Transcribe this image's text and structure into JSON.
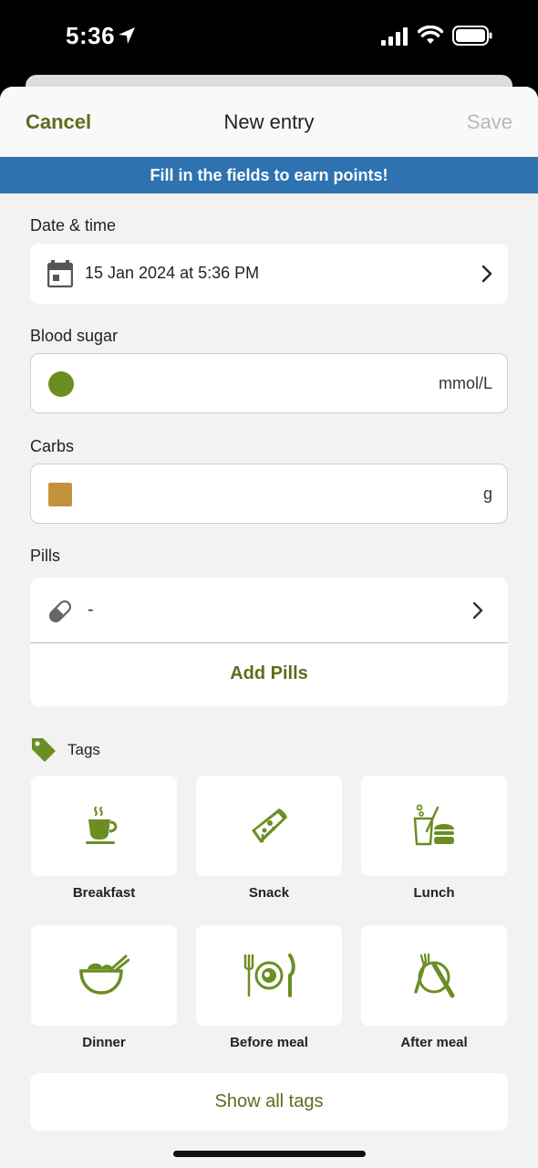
{
  "status_bar": {
    "time": "5:36"
  },
  "nav": {
    "cancel": "Cancel",
    "title": "New entry",
    "save": "Save"
  },
  "banner": {
    "text": "Fill in the fields to earn points!"
  },
  "date_time": {
    "label": "Date & time",
    "value": "15 Jan 2024 at 5:36 PM"
  },
  "blood_sugar": {
    "label": "Blood sugar",
    "unit": "mmol/L",
    "value": ""
  },
  "carbs": {
    "label": "Carbs",
    "unit": "g",
    "value": ""
  },
  "pills": {
    "label": "Pills",
    "value": "-",
    "add_label": "Add Pills"
  },
  "tags": {
    "label": "Tags",
    "items": [
      {
        "label": "Breakfast",
        "icon": "coffee-cup-icon"
      },
      {
        "label": "Snack",
        "icon": "pizza-slice-icon"
      },
      {
        "label": "Lunch",
        "icon": "burger-drink-icon"
      },
      {
        "label": "Dinner",
        "icon": "bowl-icon"
      },
      {
        "label": "Before meal",
        "icon": "plate-cutlery-icon"
      },
      {
        "label": "After meal",
        "icon": "empty-plate-icon"
      }
    ],
    "show_all": "Show all tags"
  },
  "colors": {
    "accent": "#5a6e1f",
    "icon_green": "#6b8e23",
    "banner": "#2e72b0",
    "carbs": "#c2933a"
  }
}
